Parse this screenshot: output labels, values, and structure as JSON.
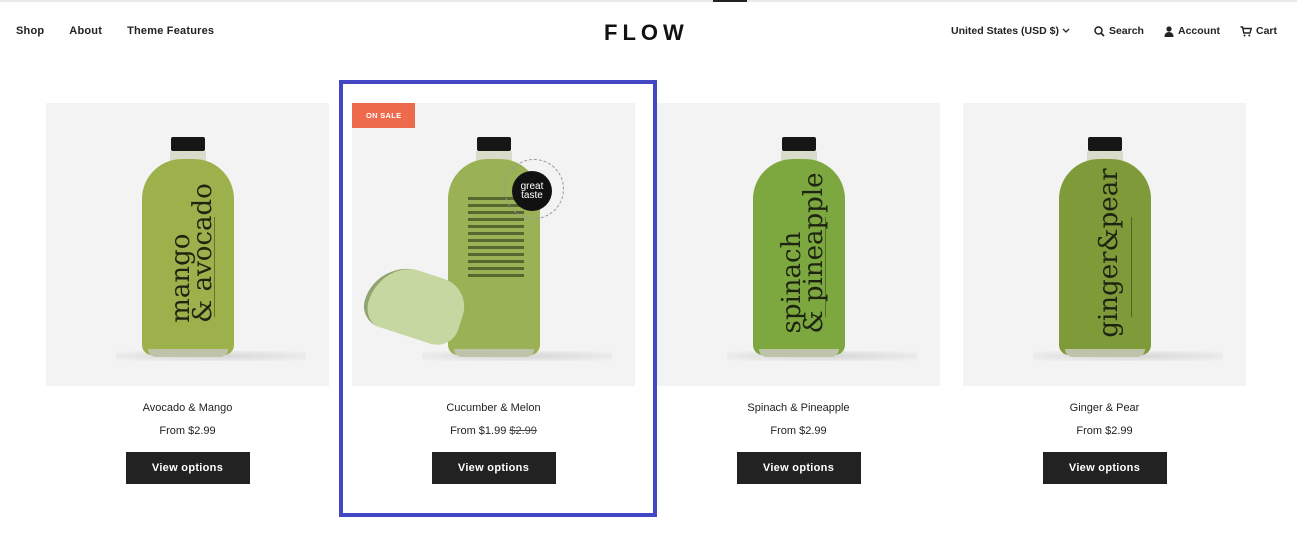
{
  "header": {
    "nav_left": [
      "Shop",
      "About",
      "Theme Features"
    ],
    "logo": "FLOW",
    "currency": "United States (USD $)",
    "search_label": "Search",
    "account_label": "Account",
    "cart_label": "Cart"
  },
  "products": [
    {
      "name": "Avocado & Mango",
      "price": "From $2.99",
      "bottle_text": "mango\n& avocado",
      "bottle_color": "#9cb14b",
      "button": "View options"
    },
    {
      "name": "Cucumber & Melon",
      "price": "From $1.99",
      "compare_price": "$2.99",
      "badge": "ON SALE",
      "award": "great taste",
      "bottle_color": "#9ab156",
      "button": "View options"
    },
    {
      "name": "Spinach & Pineapple",
      "price": "From $2.99",
      "bottle_text": "spinach\n& pineapple",
      "bottle_color": "#7da83f",
      "button": "View options"
    },
    {
      "name": "Ginger & Pear",
      "price": "From $2.99",
      "bottle_text": "ginger&pear",
      "bottle_color": "#7f9a39",
      "button": "View options"
    }
  ]
}
